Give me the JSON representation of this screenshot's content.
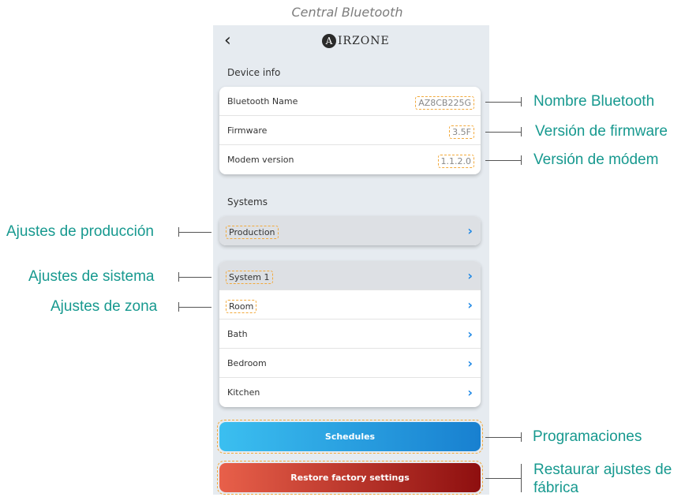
{
  "caption": "Central Bluetooth",
  "header": {
    "back_icon": "chevron-left-icon",
    "logo_initial": "A",
    "logo_text": "IRZONE"
  },
  "device_info": {
    "title": "Device info",
    "rows": [
      {
        "label": "Bluetooth Name",
        "value": "AZ8CB225G"
      },
      {
        "label": "Firmware",
        "value": "3.5F"
      },
      {
        "label": "Modem version",
        "value": "1.1.2.0"
      }
    ]
  },
  "systems": {
    "title": "Systems",
    "production": "Production",
    "items": [
      "System 1",
      "Room",
      "Bath",
      "Bedroom",
      "Kitchen"
    ]
  },
  "buttons": {
    "schedules": "Schedules",
    "restore": "Restore factory settings"
  },
  "annotations": {
    "bluetooth_name": "Nombre Bluetooth",
    "firmware": "Versión de firmware",
    "modem": "Versión de módem",
    "production": "Ajustes de producción",
    "system": "Ajustes de sistema",
    "zone": "Ajustes de zona",
    "schedules": "Programaciones",
    "restore_line1": "Restaurar ajustes de",
    "restore_line2": "fábrica"
  },
  "colors": {
    "accent": "#1e88e5",
    "annotation": "#17998f",
    "highlight": "#f2a93b"
  }
}
